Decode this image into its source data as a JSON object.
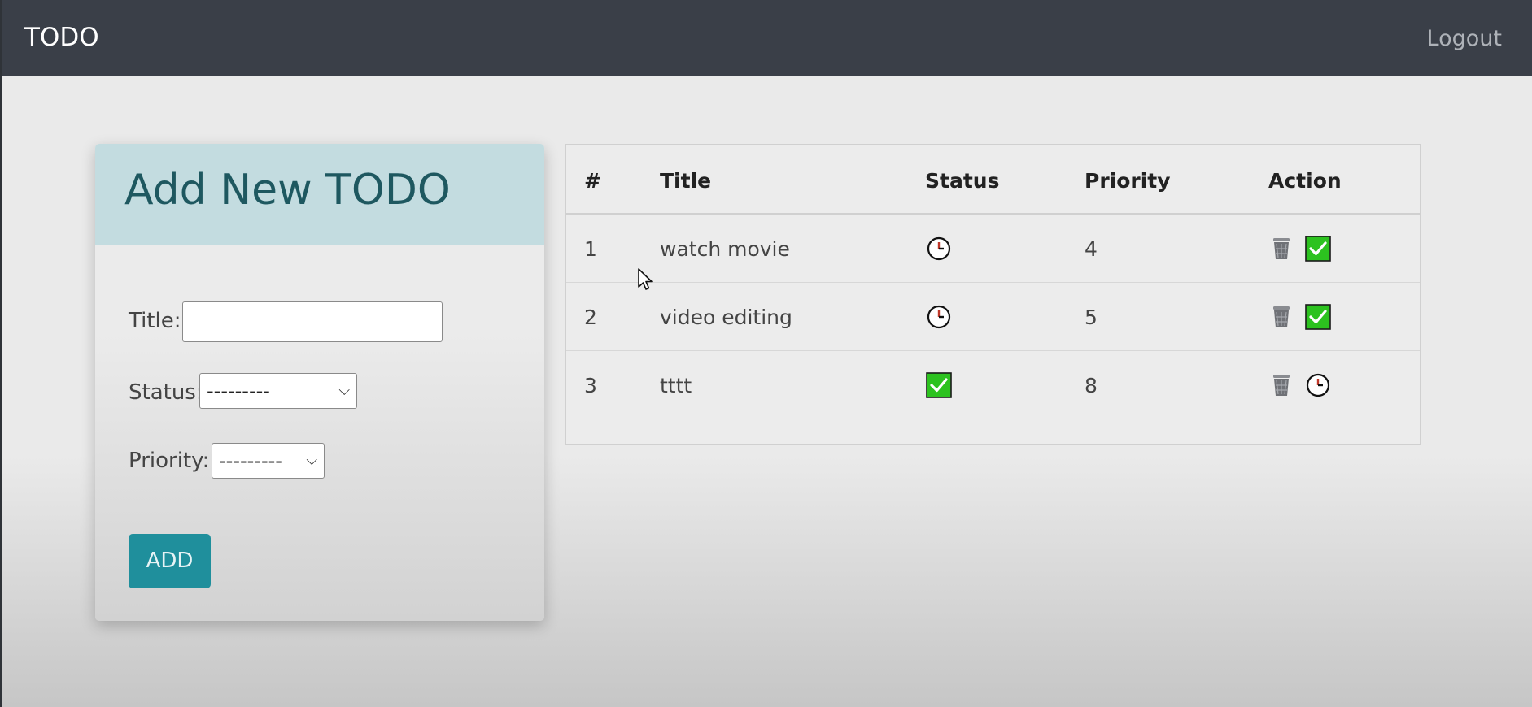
{
  "navbar": {
    "brand": "TODO",
    "logout_label": "Logout"
  },
  "form": {
    "title": "Add New TODO",
    "title_label": "Title:",
    "title_value": "",
    "status_label": "Status:",
    "status_selected": "---------",
    "priority_label": "Priority:",
    "priority_selected": "---------",
    "add_label": "ADD"
  },
  "table": {
    "headers": [
      "#",
      "Title",
      "Status",
      "Priority",
      "Action"
    ],
    "rows": [
      {
        "num": "1",
        "title": "watch movie",
        "status_icon": "clock-icon",
        "priority": "4",
        "actions": [
          "trash-icon",
          "check-icon"
        ]
      },
      {
        "num": "2",
        "title": "video editing",
        "status_icon": "clock-icon",
        "priority": "5",
        "actions": [
          "trash-icon",
          "check-icon"
        ]
      },
      {
        "num": "3",
        "title": "tttt",
        "status_icon": "check-icon",
        "priority": "8",
        "actions": [
          "trash-icon",
          "clock-icon"
        ]
      }
    ]
  },
  "colors": {
    "navbar_bg": "#3a3f48",
    "card_header_bg": "#c3dce0",
    "card_title": "#1e5860",
    "add_button_bg": "#1f8f9c",
    "check_green": "#2cc21f"
  }
}
